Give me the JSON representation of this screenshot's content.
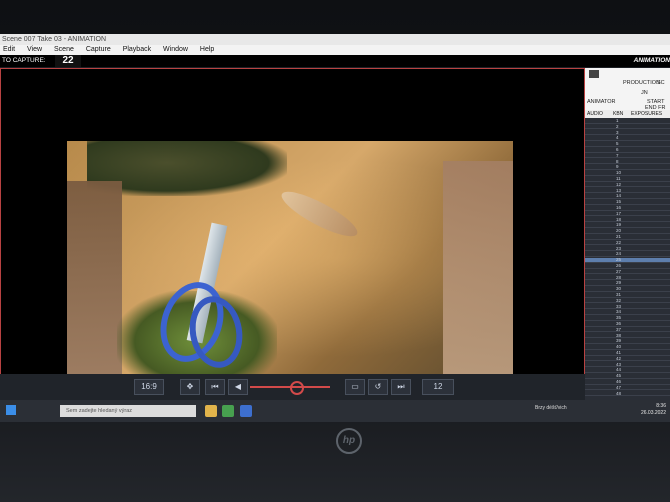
{
  "window": {
    "title": "Scene 007 Take 03 - ANIMATION"
  },
  "menu": {
    "items": [
      "Edit",
      "View",
      "Scene",
      "Capture",
      "Playback",
      "Window",
      "Help"
    ]
  },
  "capture": {
    "label": "TO CAPTURE:",
    "count": "22",
    "app_label": "ANIMATION"
  },
  "viewer": {
    "frame_counter": "22"
  },
  "controls": {
    "ratio": "16:9",
    "fps": "12"
  },
  "exposure_sheet": {
    "production": "PRODUCTION",
    "scene": "SC",
    "user": "JN",
    "animator": "ANIMATOR",
    "start": "START",
    "end": "END FR",
    "columns": [
      "AUDIO",
      "KBN",
      "EXPOSURES"
    ],
    "rows": [
      "1",
      "2",
      "3",
      "4",
      "5",
      "6",
      "7",
      "8",
      "9",
      "10",
      "11",
      "12",
      "13",
      "14",
      "15",
      "16",
      "17",
      "18",
      "19",
      "20",
      "21",
      "22",
      "23",
      "24",
      "25",
      "26",
      "27",
      "28",
      "29",
      "30",
      "31",
      "32",
      "33",
      "34",
      "35",
      "36",
      "37",
      "38",
      "39",
      "40",
      "41",
      "42",
      "43",
      "44",
      "45",
      "46",
      "47",
      "48"
    ]
  },
  "taskbar": {
    "search_placeholder": "Sem zadejte hledaný výraz",
    "weather": "Brzy déšť/vich",
    "time": "8:36",
    "date": "26.03.2022"
  },
  "colors": {
    "accent": "#b84242",
    "panel": "#242830",
    "taskbar": "#2b2f36"
  }
}
